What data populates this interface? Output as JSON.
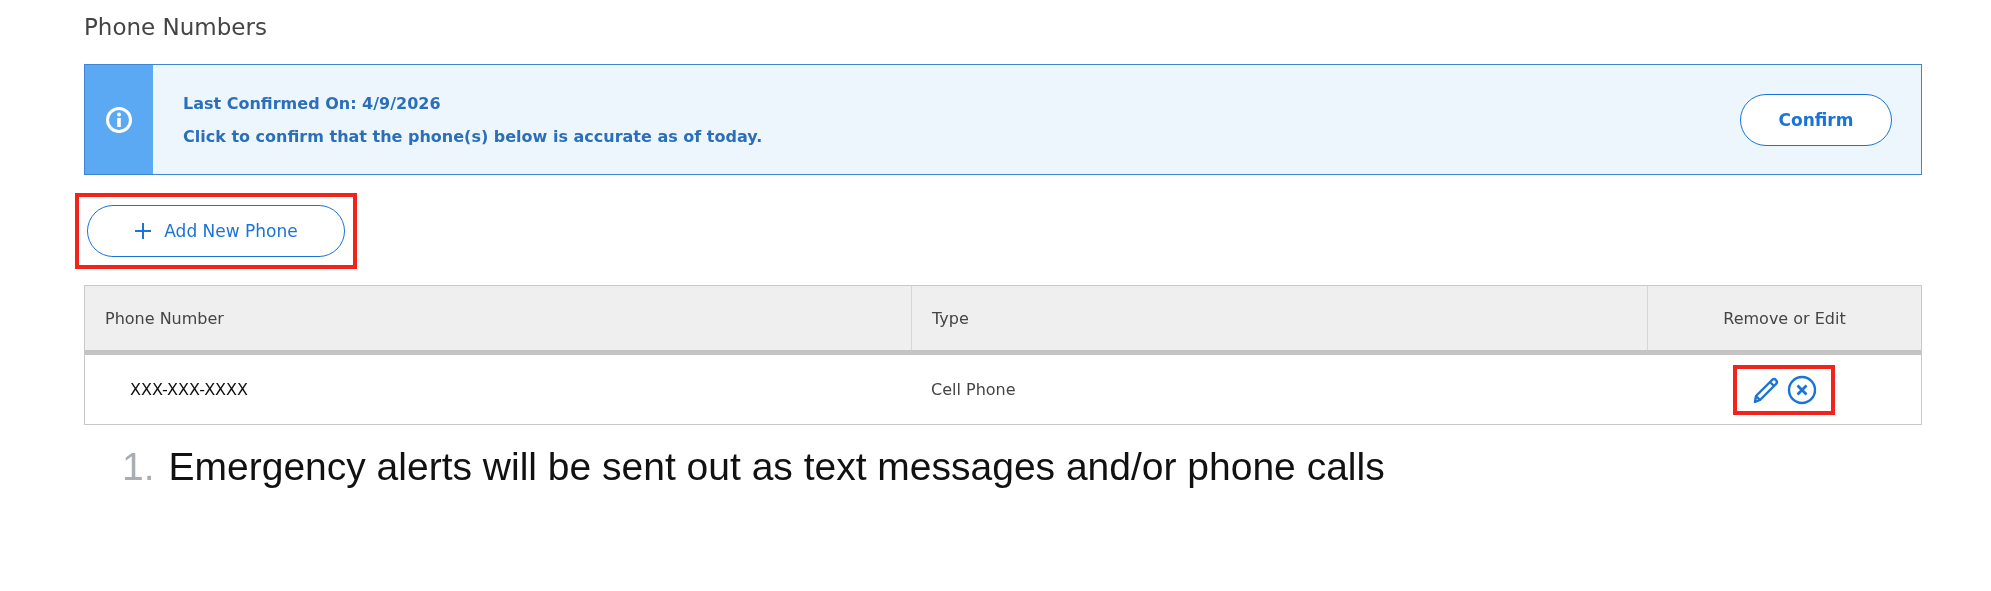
{
  "section_title": "Phone Numbers",
  "notice": {
    "title": "Last Confirmed On: 4/9/2026",
    "message": "Click to confirm that the phone(s) below is accurate as of today.",
    "button": "Confirm"
  },
  "add_button": {
    "label": "Add New Phone",
    "highlighted": true
  },
  "table": {
    "columns": [
      "Phone Number",
      "Type",
      "Remove or Edit"
    ],
    "rows": [
      {
        "phone_number": "XXX-XXX-XXXX",
        "type": "Cell Phone",
        "actions_highlighted": true
      }
    ]
  },
  "list": [
    {
      "number": "1.",
      "text": "Emergency alerts will be sent out as text messages and/or phone calls"
    }
  ]
}
